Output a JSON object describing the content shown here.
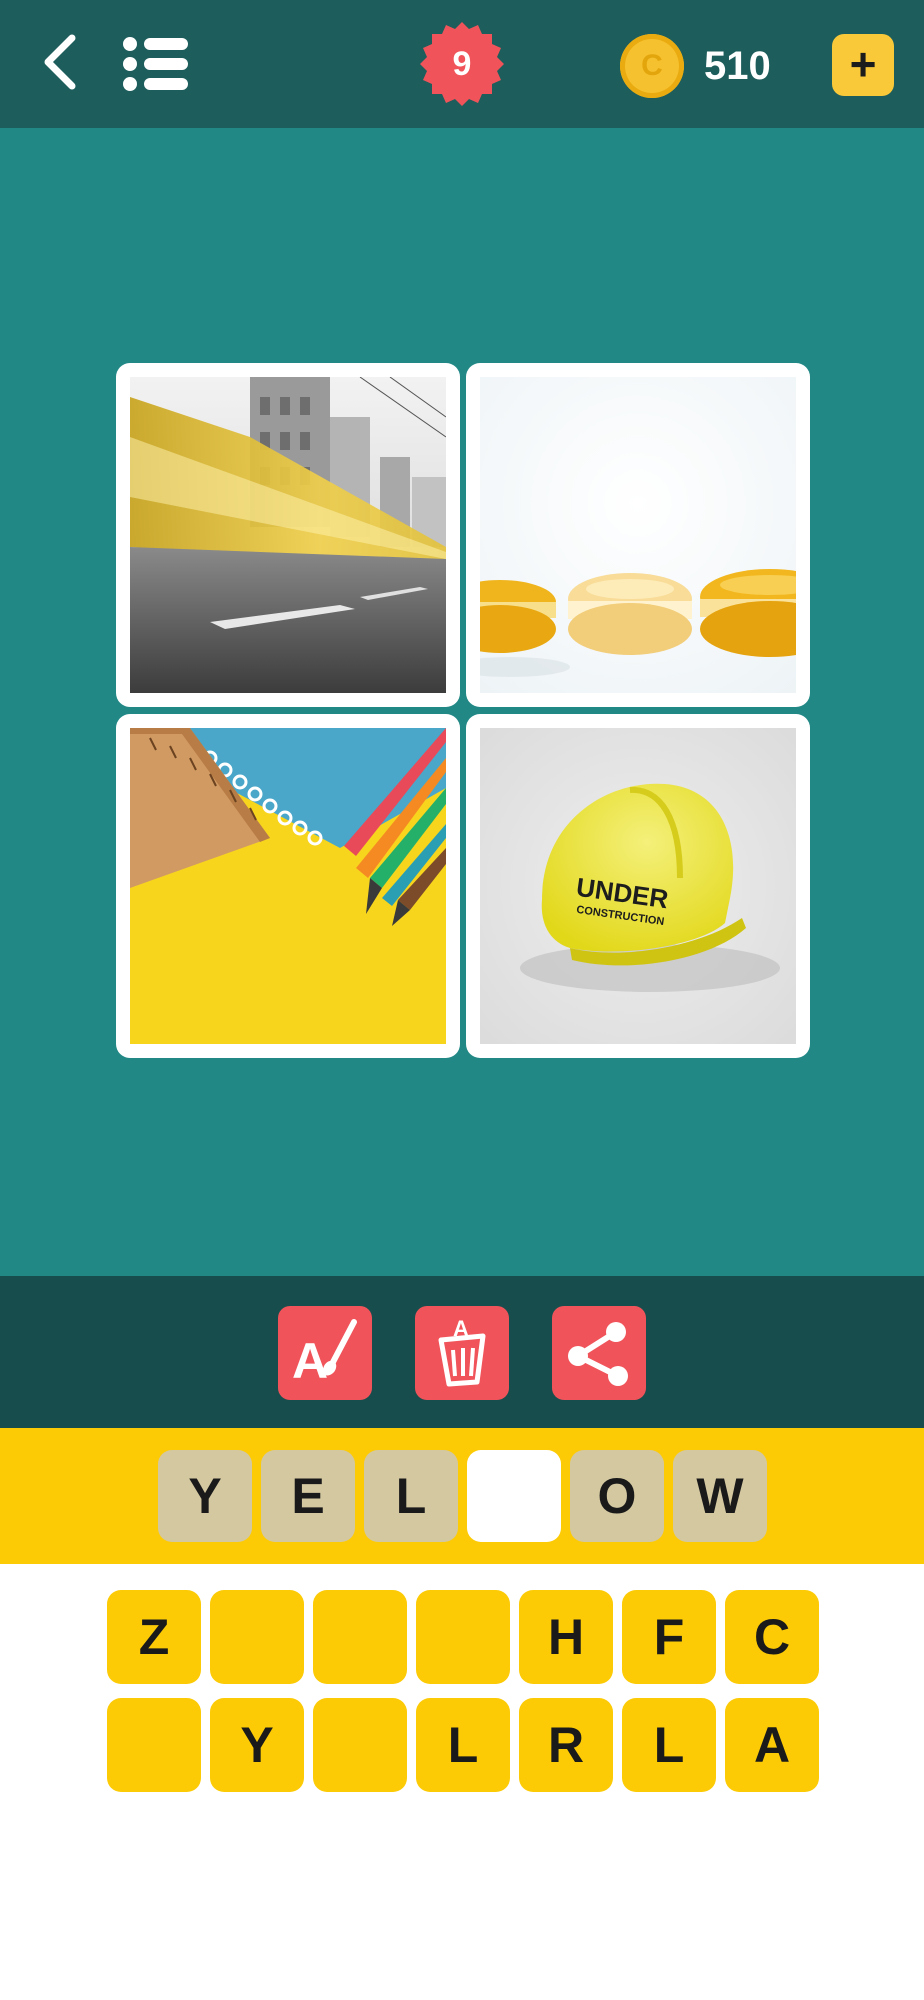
{
  "header": {
    "level": "9",
    "coin_symbol": "C",
    "coins": "510",
    "add_symbol": "+"
  },
  "puzzle": {
    "images": [
      {
        "name": "blurred-yellow-tram-street"
      },
      {
        "name": "yellow-macarons"
      },
      {
        "name": "ruler-notebook-pencils-on-yellow"
      },
      {
        "name": "yellow-hard-hat",
        "label_line1": "UNDER",
        "label_line2": "CONSTRUCTION"
      }
    ]
  },
  "toolbar": {
    "tools": [
      "reveal-letter",
      "remove-letters",
      "share"
    ]
  },
  "answer": {
    "slots": [
      "Y",
      "E",
      "L",
      "",
      "O",
      "W"
    ]
  },
  "keyboard": {
    "row1": [
      "Z",
      "",
      "",
      "",
      "H",
      "F",
      "C"
    ],
    "row2": [
      "",
      "Y",
      "",
      "L",
      "R",
      "L",
      "A"
    ]
  },
  "colors": {
    "header_bg": "#1d5d5b",
    "main_bg": "#218886",
    "toolbar_bg": "#174e4d",
    "accent_red": "#f0545a",
    "accent_yellow": "#fccb06",
    "slot_filled": "#d4c8a0"
  }
}
